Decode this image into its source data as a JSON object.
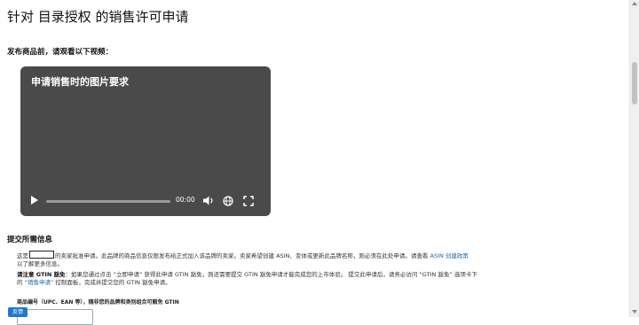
{
  "page": {
    "title": "针对 目录授权 的销售许可申请",
    "prompt": "发布商品前，请观看以下视频："
  },
  "video": {
    "title": "申请销售时的图片要求",
    "time": "00:00",
    "progress": 0,
    "icons": [
      "play-icon",
      "volume-icon",
      "globe-icon",
      "fullscreen-icon"
    ]
  },
  "section": {
    "heading": "提交所需信息",
    "para1_before": "这是",
    "para1_after": "的卖家批准申请。此品牌的商品信息仅限发布给正式加入该品牌的卖家。卖家希望创建 ASIN、变体或更新此品牌名称，则必须在此处申请。请查看",
    "para1_link": "ASIN 创建政策",
    "para1_end": "以了解更多信息。",
    "para2_bold": "请注意 GTIN 豁免",
    "para2_a": "：如果您通过点击 “立即申请” 获得此申请 GTIN 豁免，则还需要提交 GTIN 豁免申请才能完成您的上市体验。 提交此申请后，请务必访问 “GTIN 豁免” 选项卡下的",
    "para2_link": "“销售申请”",
    "para2_b": "控制面板，完成并提交您的 GTIN 豁免申请。"
  },
  "form": {
    "field_label": "商品编号（UPC、EAN 等），随非您的品牌和类别组合可豁免 GTIN",
    "field_value": "",
    "feedback_label": "反馈"
  },
  "colors": {
    "link": "#1f6aa5",
    "video_bg": "#4a4a4a",
    "feedback": "#1f78d1"
  }
}
